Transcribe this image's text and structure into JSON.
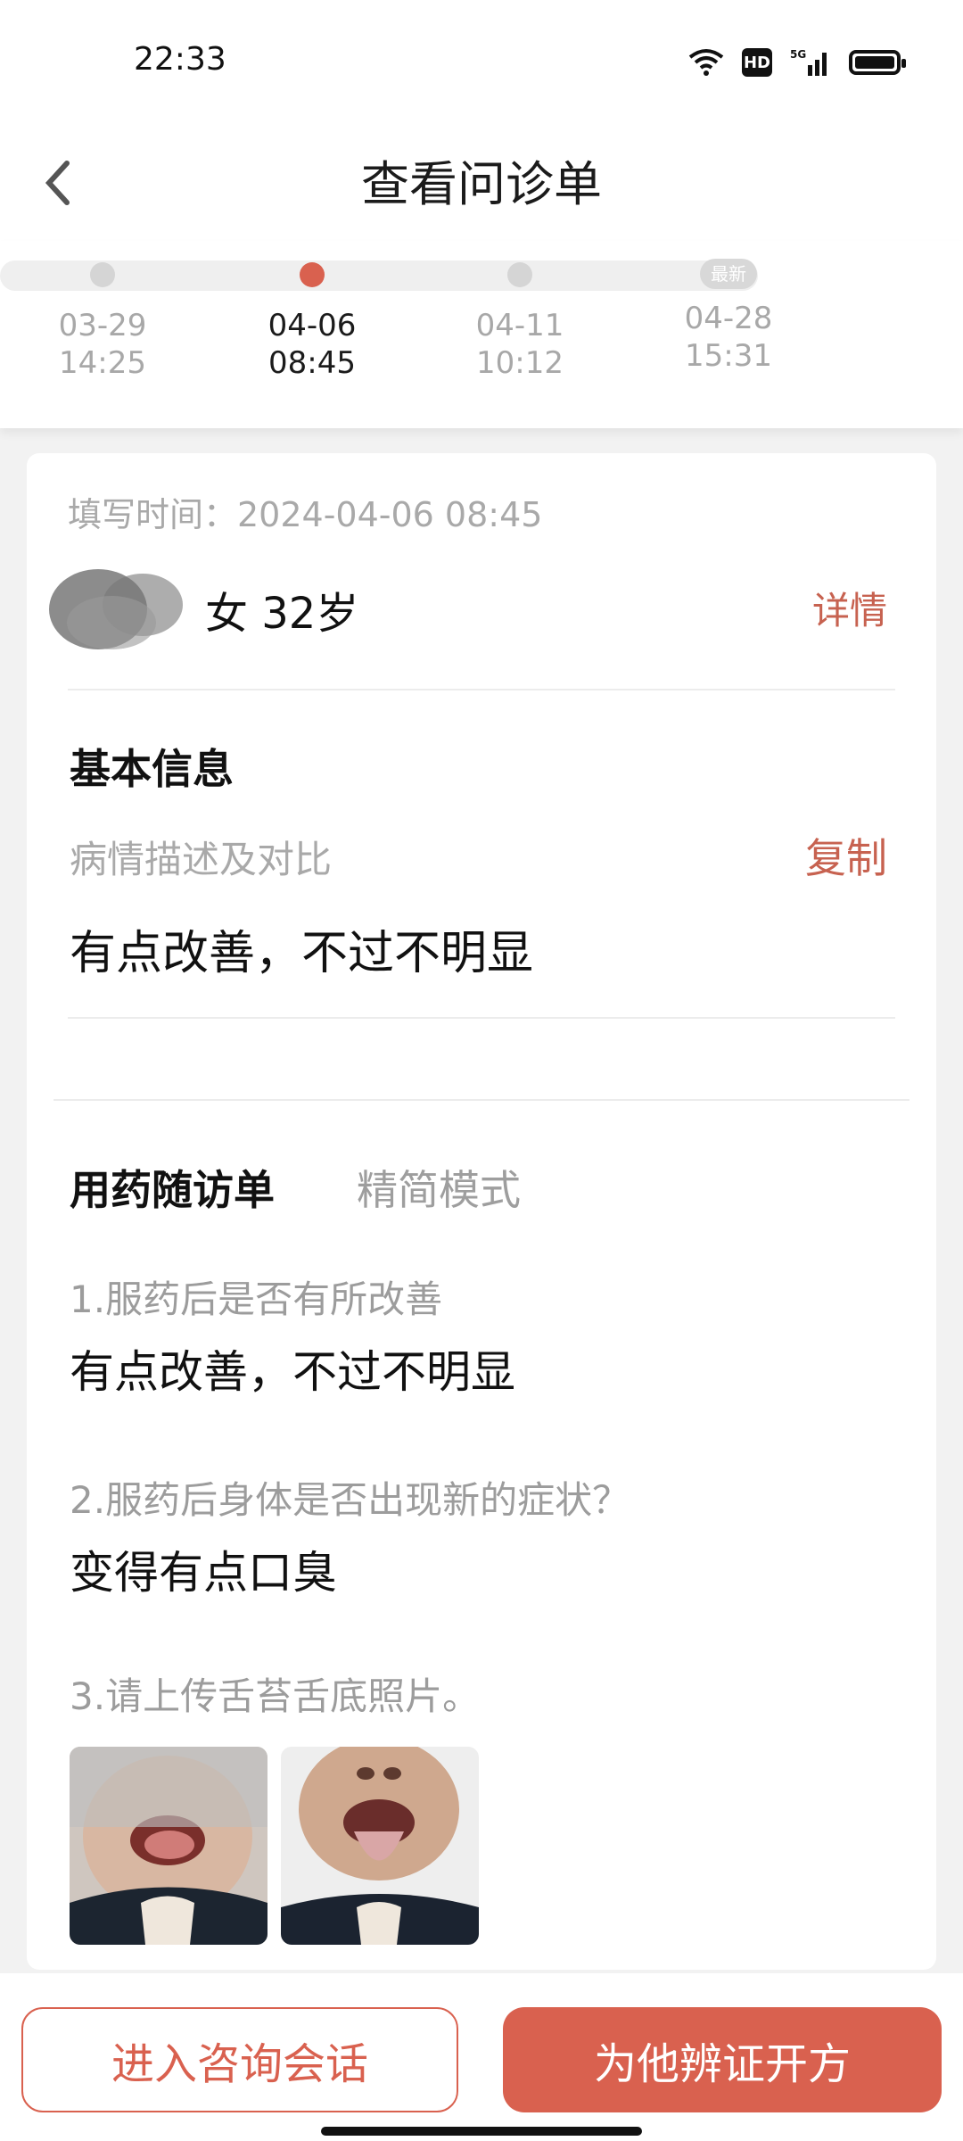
{
  "status_bar": {
    "time": "22:33",
    "network": "5G",
    "hd": "HD"
  },
  "header": {
    "title": "查看问诊单",
    "back_icon": "back-arrow-icon"
  },
  "timeline": [
    {
      "date": "03-29",
      "time": "14:25",
      "active": false,
      "badge": ""
    },
    {
      "date": "04-06",
      "time": "08:45",
      "active": true,
      "badge": ""
    },
    {
      "date": "04-11",
      "time": "10:12",
      "active": false,
      "badge": ""
    },
    {
      "date": "04-28",
      "time": "15:31",
      "active": false,
      "badge": "最新"
    }
  ],
  "card": {
    "fill_time": "填写时间：2024-04-06 08:45",
    "patient": "女 32岁",
    "detail_label": "详情",
    "basic_info_title": "基本信息",
    "condition_label": "病情描述及对比",
    "copy_label": "复制",
    "condition_value": "有点改善，不过不明显",
    "followup_title": "用药随访单",
    "mode_label": "精简模式",
    "questions": [
      {
        "q": "1.服药后是否有所改善",
        "a": "有点改善，不过不明显"
      },
      {
        "q": "2.服药后身体是否出现新的症状？",
        "a": "变得有点口臭"
      },
      {
        "q": "3.请上传舌苔舌底照片。",
        "a": ""
      }
    ]
  },
  "bottom": {
    "enter_chat": "进入咨询会话",
    "prescribe": "为他辨证开方"
  },
  "colors": {
    "accent": "#d9614f",
    "link": "#c76250"
  }
}
